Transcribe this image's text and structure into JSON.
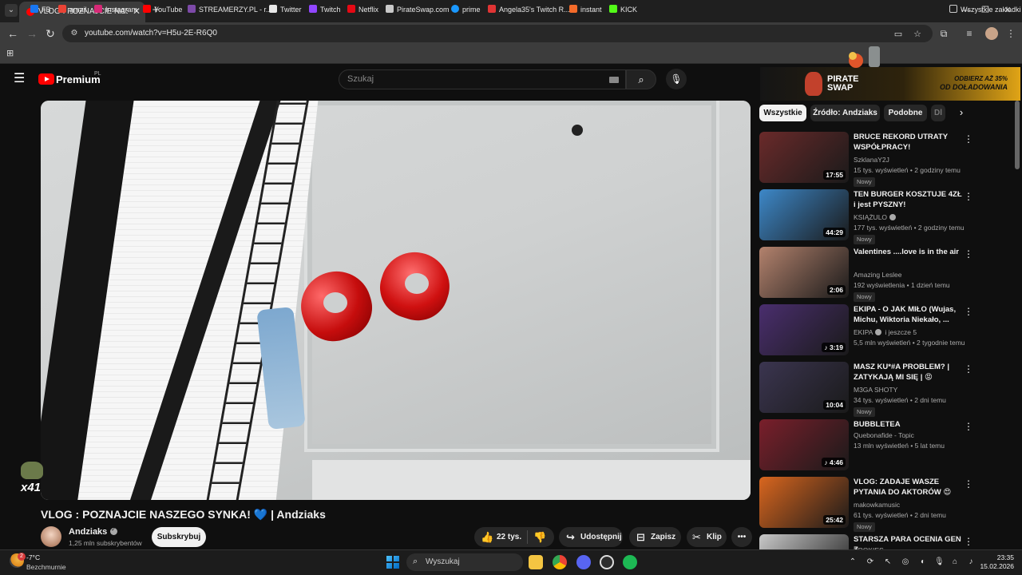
{
  "browser": {
    "tab_title": "VLOG : POZNAJCIE NASZEGO SYNKA! 💙 | Andziaks",
    "url": "youtube.com/watch?v=H5u-2E-R6Q0",
    "bookmarks": [
      "FB",
      "gmail",
      "Instagram",
      "YouTube",
      "STREAMERZY.PL - r...",
      "Twitter",
      "Twitch",
      "Netflix",
      "PirateSwap.com",
      "prime",
      "Angela35's Twitch R...",
      "instant",
      "KICK"
    ],
    "all_bookmarks": "Wszystkie zakładki"
  },
  "youtube": {
    "brand": "Premium",
    "region": "PL",
    "search_placeholder": "Szukaj"
  },
  "ad": {
    "brand": "PIRATE SWAP",
    "cta_line1": "ODBIERZ AŻ 35%",
    "cta_line2": "OD DOŁADOWANIA"
  },
  "video": {
    "overlay_counter": "x41",
    "title": "VLOG : POZNAJCIE NASZEGO SYNKA! 💙 | Andziaks",
    "channel": "Andziaks",
    "subscribers": "1,25 mln subskrybentów",
    "subscribe_label": "Subskrybuj",
    "likes": "22 tys.",
    "share_label": "Udostępnij",
    "save_label": "Zapisz",
    "clip_label": "Klip",
    "more_label": "•••"
  },
  "sidebar": {
    "chips": [
      "Wszystkie",
      "Źródło: Andziaks",
      "Podobne",
      "Dl"
    ],
    "recommendations": [
      {
        "title": "BRUCE REKORD UTRATY WSPÓŁPRACY! WALENTYNKI ...",
        "channel": "SzklanaY2J",
        "meta": "15 tys. wyświetleń • 2 godziny temu",
        "badge": "Nowy",
        "duration": "17:55",
        "thumb": "#6a2a2a",
        "verified": false
      },
      {
        "title": "TEN BURGER KOSZTUJE 4ZŁ i jest PYSZNY!",
        "channel": "KSIĄŻULO",
        "meta": "177 tys. wyświetleń • 2 godziny temu",
        "badge": "Nowy",
        "duration": "44:29",
        "thumb": "#3d88c9",
        "verified": true
      },
      {
        "title": "Valentines ....love is in the air",
        "channel": "Amazing Leslee",
        "meta": "192 wyświetlenia • 1 dzień temu",
        "badge": "Nowy",
        "duration": "2:06",
        "thumb": "#b3826d",
        "verified": false
      },
      {
        "title": "EKIPA - O JAK MIŁO (Wujas, Michu, Wiktoria Niekało, ...",
        "channel": "EKIPA",
        "channel_suffix": "i jeszcze 5",
        "meta": "5,5 mln wyświetleń • 2 tygodnie temu",
        "badge": "",
        "duration": "♪ 3:19",
        "thumb": "#4a2e6e",
        "verified": true
      },
      {
        "title": "MASZ KU*#A PROBLEM? | ZATYKAJĄ MI SIĘ | 😡 POLSKI...",
        "channel": "M3GA SHOTY",
        "meta": "34 tys. wyświetleń • 2 dni temu",
        "badge": "Nowy",
        "duration": "10:04",
        "thumb": "#3b3550",
        "verified": false
      },
      {
        "title": "BUBBLETEA",
        "channel": "Quebonafide - Topic",
        "meta": "13 mln wyświetleń • 5 lat temu",
        "badge": "",
        "duration": "♪ 4:46",
        "thumb": "#7a1f2b",
        "verified": false
      },
      {
        "title": "VLOG: ZADAJE WASZE PYTANIA DO AKTORÓW 😍",
        "channel": "makowkamusic",
        "meta": "61 tys. wyświetleń • 2 dni temu",
        "badge": "Nowy",
        "duration": "25:42",
        "thumb": "#d9661e",
        "verified": false
      },
      {
        "title": "STARSZA PARA OCENIA GEN Z",
        "channel": "BROKIES",
        "meta": "",
        "badge": "",
        "duration": "",
        "thumb": "#c9c9c9",
        "verified": false
      }
    ]
  },
  "taskbar": {
    "temperature": "-7°C",
    "weather": "Bezchmurnie",
    "search_placeholder": "Wyszukaj",
    "time": "23:35",
    "date": "15.02.2026",
    "weather_badge": "2"
  },
  "colors": {
    "accent": "#ff0000",
    "bg": "#0f0f0f",
    "chip_bg": "#272727"
  }
}
